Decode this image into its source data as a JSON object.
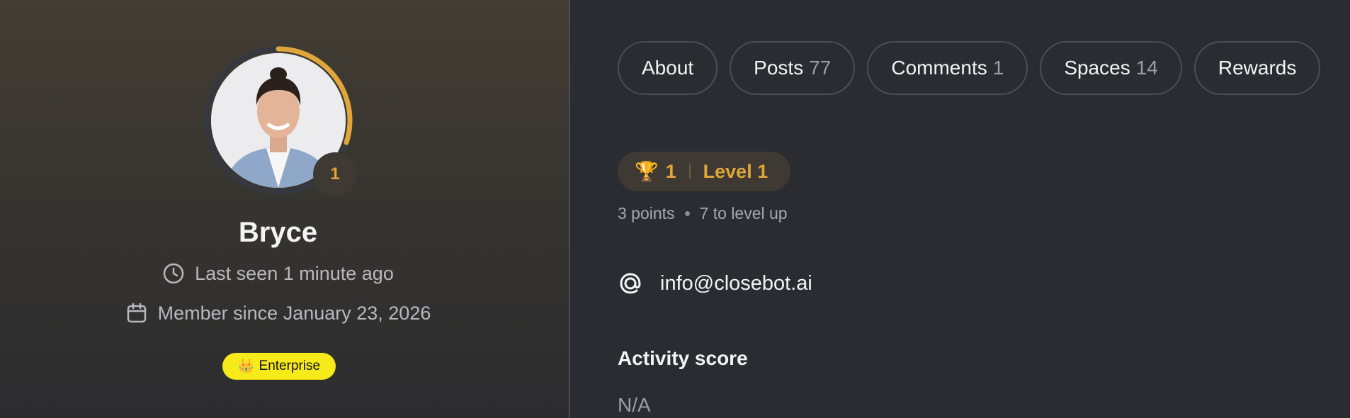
{
  "profile": {
    "name": "Bryce",
    "level_number": "1",
    "last_seen": "Last seen 1 minute ago",
    "member_since": "Member since January 23, 2026",
    "plan_badge": "Enterprise",
    "plan_icon": "crown-emoji",
    "level_progress_fraction": 0.3
  },
  "tabs": [
    {
      "label": "About",
      "count": ""
    },
    {
      "label": "Posts",
      "count": "77"
    },
    {
      "label": "Comments",
      "count": "1"
    },
    {
      "label": "Spaces",
      "count": "14"
    },
    {
      "label": "Rewards",
      "count": ""
    }
  ],
  "level": {
    "rank": "1",
    "label": "Level 1",
    "points": "3 points",
    "to_level_up": "7 to level up"
  },
  "contact": {
    "email": "info@closebot.ai"
  },
  "activity": {
    "title": "Activity score",
    "value": "N/A"
  },
  "colors": {
    "accent_gold": "#e0a63a",
    "plan_badge_bg": "#f7ea1a",
    "background": "#2a2c31"
  }
}
